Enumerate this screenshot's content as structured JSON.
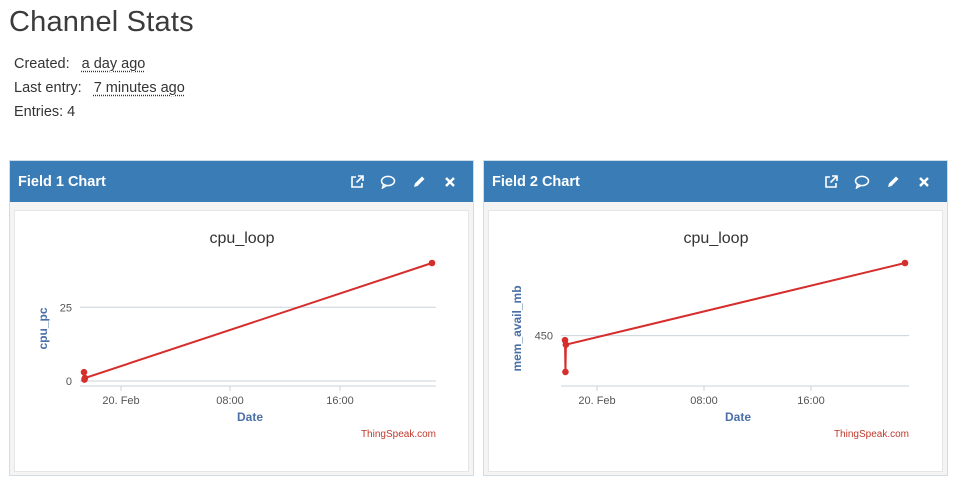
{
  "page": {
    "title": "Channel Stats"
  },
  "stats": {
    "created_label": "Created:",
    "created_value": "a day ago",
    "last_entry_label": "Last entry:",
    "last_entry_value": "7 minutes ago",
    "entries_label": "Entries: 4"
  },
  "panels": [
    {
      "title": "Field 1 Chart",
      "tools": [
        "external-link-icon",
        "comment-icon",
        "pencil-icon",
        "close-icon"
      ]
    },
    {
      "title": "Field 2 Chart",
      "tools": [
        "external-link-icon",
        "comment-icon",
        "pencil-icon",
        "close-icon"
      ]
    }
  ],
  "colors": {
    "panel_header": "#3a7db6",
    "series": "#d62d2d",
    "axis_title": "#4a6fa5",
    "credit": "#c0392b"
  },
  "chart_data": [
    {
      "type": "line",
      "title": "cpu_loop",
      "xlabel": "Date",
      "ylabel": "cpu_pc",
      "x_ticks": [
        "20. Feb",
        "08:00",
        "16:00"
      ],
      "y_ticks": [
        0,
        25
      ],
      "x": [
        "Feb 19 19:55",
        "Feb 19 19:57",
        "Feb 19 19:59",
        "Feb 21 00:10"
      ],
      "values": [
        3,
        0.5,
        1,
        40
      ],
      "ylim": [
        0,
        40
      ],
      "grid": true,
      "credit": "ThingSpeak.com"
    },
    {
      "type": "line",
      "title": "cpu_loop",
      "xlabel": "Date",
      "ylabel": "mem_avail_mb",
      "x_ticks": [
        "20. Feb",
        "08:00",
        "16:00"
      ],
      "y_ticks": [
        450
      ],
      "x": [
        "Feb 19 19:55",
        "Feb 19 19:57",
        "Feb 19 19:59",
        "Feb 21 00:10"
      ],
      "values": [
        445,
        410,
        440,
        530
      ],
      "ylim": [
        400,
        530
      ],
      "grid": true,
      "credit": "ThingSpeak.com"
    }
  ]
}
